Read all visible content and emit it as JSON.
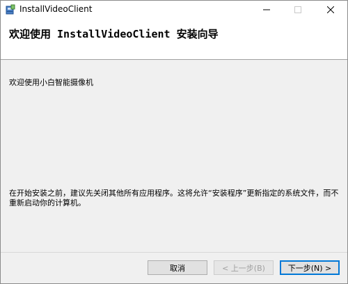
{
  "window": {
    "title": "InstallVideoClient"
  },
  "header": {
    "title": "欢迎使用 InstallVideoClient 安装向导"
  },
  "content": {
    "welcome": "欢迎使用小白智能摄像机",
    "notice": "在开始安装之前，建议先关闭其他所有应用程序。这将允许“安装程序”更新指定的系统文件，而不重新启动你的计算机。"
  },
  "buttons": {
    "cancel": "取消",
    "back": "< 上一步(B)",
    "next": "下一步(N) >"
  },
  "icons": {
    "app": "installer-icon",
    "minimize": "minimize-icon",
    "maximize": "maximize-icon",
    "close": "close-icon"
  },
  "colors": {
    "accent": "#0078d7",
    "window_bg": "#f0f0f0"
  }
}
